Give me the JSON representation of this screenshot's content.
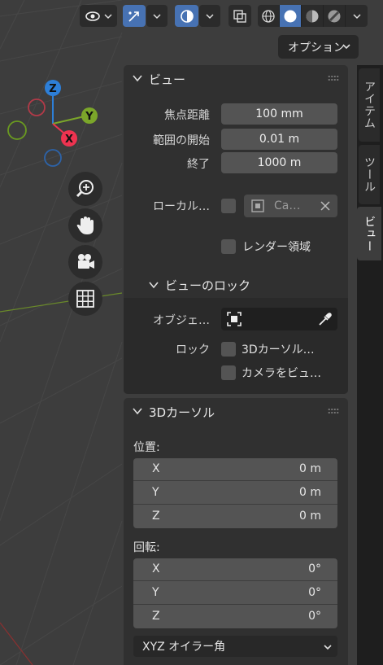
{
  "header": {
    "options_label": "オプション"
  },
  "gizmo": {
    "axis_x": "X",
    "axis_y": "Y",
    "axis_z": "Z",
    "colors": {
      "x": "#ee3350",
      "y": "#7ba62a",
      "z": "#2d7fd8"
    }
  },
  "side_tabs": [
    {
      "label": "アイテム",
      "active": false
    },
    {
      "label": "ツール",
      "active": false
    },
    {
      "label": "ビュー",
      "active": true
    }
  ],
  "view_panel": {
    "title": "ビュー",
    "focal_length_label": "焦点距離",
    "focal_length_value": "100 mm",
    "clip_start_label": "範囲の開始",
    "clip_start_value": "0.01 m",
    "clip_end_label": "終了",
    "clip_end_value": "1000 m",
    "local_camera_label": "ローカル…",
    "local_camera_value": "Ca…",
    "render_region_label": "レンダー領域",
    "view_lock": {
      "title": "ビューのロック",
      "object_label": "オブジェ…",
      "lock_label": "ロック",
      "lock_cursor_label": "3Dカーソル…",
      "lock_camera_label": "カメラをビュ…"
    }
  },
  "cursor_panel": {
    "title": "3Dカーソル",
    "location_label": "位置:",
    "location": [
      {
        "axis": "X",
        "value": "0 m"
      },
      {
        "axis": "Y",
        "value": "0 m"
      },
      {
        "axis": "Z",
        "value": "0 m"
      }
    ],
    "rotation_label": "回転:",
    "rotation": [
      {
        "axis": "X",
        "value": "0°"
      },
      {
        "axis": "Y",
        "value": "0°"
      },
      {
        "axis": "Z",
        "value": "0°"
      }
    ],
    "rotation_mode": "XYZ オイラー角"
  },
  "accent_color": "#4772b3"
}
